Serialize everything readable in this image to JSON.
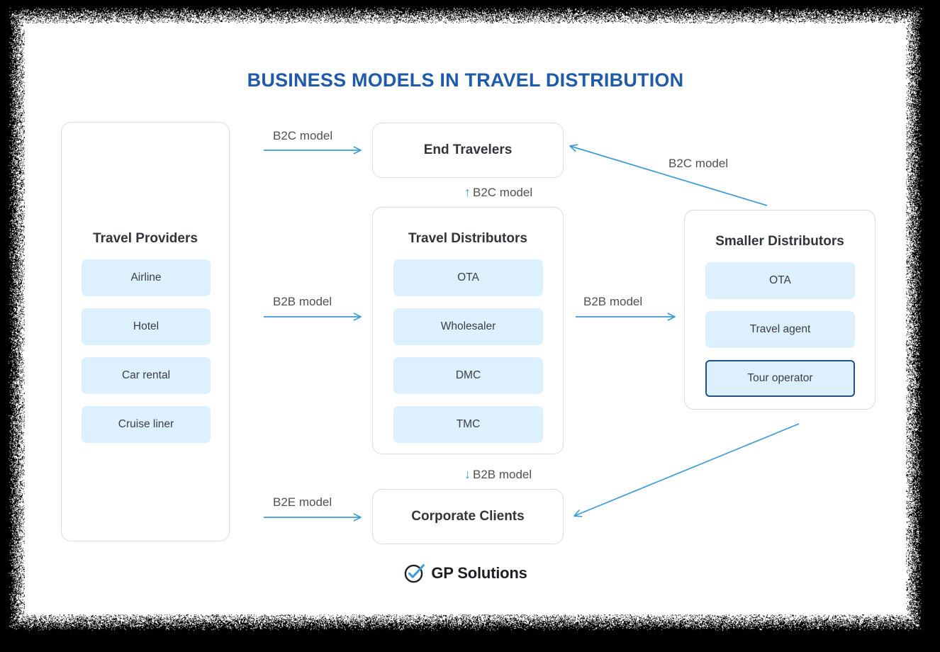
{
  "title": "BUSINESS MODELS IN TRAVEL DISTRIBUTION",
  "colors": {
    "title_blue": "#1f5ba8",
    "arrow_blue": "#3e9bd5",
    "chip_fill": "#ddf0fd",
    "panel_border": "#d7dbe4",
    "highlight_border": "#1f5187",
    "text_dark": "#313438",
    "label_gray": "#4e5155"
  },
  "panels": {
    "travel_providers": {
      "title": "Travel Providers",
      "items": [
        "Airline",
        "Hotel",
        "Car rental",
        "Cruise liner"
      ]
    },
    "travel_distributors": {
      "title": "Travel Distributors",
      "items": [
        "OTA",
        "Wholesaler",
        "DMC",
        "TMC"
      ]
    },
    "smaller_distributors": {
      "title": "Smaller Distributors",
      "items": [
        "OTA",
        "Travel agent",
        "Tour operator"
      ],
      "highlighted_item": "Tour operator"
    }
  },
  "nodes": {
    "end_travelers": "End Travelers",
    "corporate_clients": "Corporate Clients"
  },
  "edges": {
    "providers_to_end_travelers": "B2C model",
    "providers_to_distributors": "B2B model",
    "providers_to_corporate": "B2E model",
    "distributors_to_smaller": "B2B model",
    "smaller_to_end_travelers": "B2C model",
    "distributors_up_to_end_travelers": {
      "glyph": "↑",
      "label": "B2C model"
    },
    "distributors_down_to_corporate": {
      "glyph": "↓",
      "label": "B2B model"
    }
  },
  "logo": {
    "text": "GP Solutions",
    "icon": "check-circle-icon"
  }
}
